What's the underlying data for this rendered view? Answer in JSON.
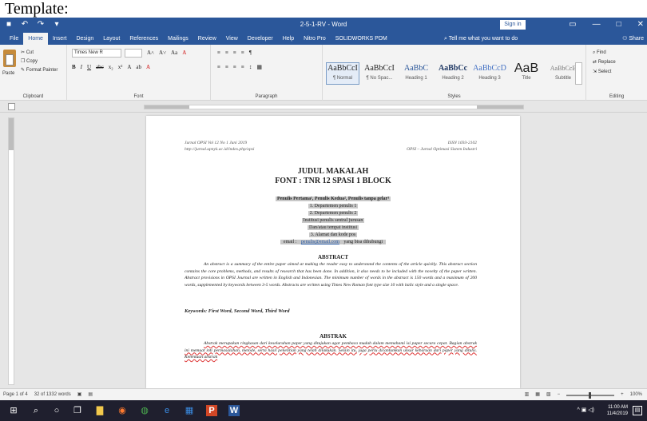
{
  "caption": "Template:",
  "titlebar": {
    "qat_icons": [
      "save-icon",
      "undo-icon",
      "redo-icon",
      "customize-icon"
    ],
    "qat_glyphs": [
      "■",
      "↶",
      "↷",
      "▾"
    ],
    "title": "2-5-1-RV - Word",
    "sign_in": "Sign in",
    "controls": [
      "▭",
      "—",
      "□",
      "✕"
    ]
  },
  "tabs": [
    "File",
    "Home",
    "Insert",
    "Design",
    "Layout",
    "References",
    "Mailings",
    "Review",
    "View",
    "Developer",
    "Help",
    "Nitro Pro",
    "SOLIDWORKS PDM"
  ],
  "active_tab": "Home",
  "tell_me": "Tell me what you want to do",
  "share": "Share",
  "ribbon": {
    "clipboard": {
      "paste": "Paste",
      "cut": "Cut",
      "copy": "Copy",
      "format_painter": "Format Painter",
      "label": "Clipboard"
    },
    "font": {
      "name": "Times New R",
      "size": "",
      "row1": [
        "A˄",
        "A˅",
        "Aa",
        "A"
      ],
      "row2": [
        "B",
        "I",
        "U",
        "abc",
        "x₂",
        "x²",
        "A",
        "ab",
        "A"
      ],
      "label": "Font"
    },
    "paragraph": {
      "row1": [
        "≡",
        "≡",
        "≡",
        "≡",
        "¶"
      ],
      "row2": [
        "≡",
        "≡",
        "≡",
        "≡",
        "↕",
        "▦"
      ],
      "label": "Paragraph"
    },
    "styles": {
      "items": [
        {
          "sample": "AaBbCcI",
          "name": "¶ Normal"
        },
        {
          "sample": "AaBbCcI",
          "name": "¶ No Spac..."
        },
        {
          "sample": "AaBbC",
          "name": "Heading 1"
        },
        {
          "sample": "AaBbCc",
          "name": "Heading 2"
        },
        {
          "sample": "AaBbCcD",
          "name": "Heading 3"
        },
        {
          "sample": "AaB",
          "name": "Title"
        },
        {
          "sample": "AaBbCcE",
          "name": "Subtitle"
        }
      ],
      "label": "Styles"
    },
    "editing": {
      "find": "Find",
      "replace": "Replace",
      "select": "Select",
      "label": "Editing"
    }
  },
  "document": {
    "header_left_1": "Jurnal OPSI Vol 12 No 1 Juni 2019",
    "header_left_2": "http://jurnal.upnyk.ac.id/index.php/opsi",
    "header_right_1": "ISSN 1693-2102",
    "header_right_2": "OPSI – Jurnal Optimasi Sistem Industri",
    "title_1": "JUDUL MAKALAH",
    "title_2": "FONT : TNR 12 SPASI 1 BLOCK",
    "authors": "Penulis Pertama¹, Penulis Kedua², Penulis tanpa gelar³",
    "affiliations": [
      "1. Departemen penulis 1",
      "2. Departemen penulis 2",
      "Institusi penulis sentral jurusan",
      "Dan/atau tempat institusi",
      "3. Alamat dan kode pos"
    ],
    "email_prefix": "email : ",
    "email_link": "penulis@email.com",
    "email_suffix": " yang bisa dihubungi",
    "abstract_heading": "ABSTRACT",
    "abstract_text": "An abstract is a summary of the entire paper aimed at making the reader easy to understand the contents of the article quickly. This abstract section contains the core problems, methods, and results of research that has been done. In addition, it also needs to be included with the novelty of the paper written. Abstract provisions in OPSI Journal are written in English and Indonesian. The minimum number of words in the abstract is 150 words and a maximum of 200 words, supplemented by keywords between 3-5 words. Abstracts are written using Times New Roman font type size 10 with italic style and a single space.",
    "keywords": "Keywords: First Word, Second Word, Third Word",
    "abstrak_heading": "ABSTRAK",
    "abstrak_text": "Abstrak merupakan ringkasan dari keseluruhan paper yang ditujukan agar pembaca mudah dalam memahami isi paper secara cepat. Bagian abstrak ini memuat inti permasalahan, metode, serta hasil penelitian yang telah dilakukan. Selain itu, juga perlu dicantumkan unsur kebaruan dari paper yang ditulis. Ketentuan abstrak"
  },
  "status": {
    "page": "Page 1 of 4",
    "words": "32 of 1332 words",
    "zoom": "100%"
  },
  "taskbar": {
    "icons": [
      "windows-icon",
      "search-icon",
      "cortana-icon",
      "task-view-icon",
      "file-explorer-icon",
      "firefox-icon",
      "chrome-icon",
      "edge-icon",
      "store-icon",
      "powerpoint-icon",
      "word-icon"
    ],
    "glyphs": [
      "⊞",
      "⌕",
      "○",
      "❐",
      "▇",
      "◉",
      "◍",
      "e",
      "▦",
      "P",
      "W"
    ],
    "tray": "^ ▣ ◁)",
    "time": "11:00 AM",
    "date": "11/4/2019",
    "notification": "▤"
  }
}
